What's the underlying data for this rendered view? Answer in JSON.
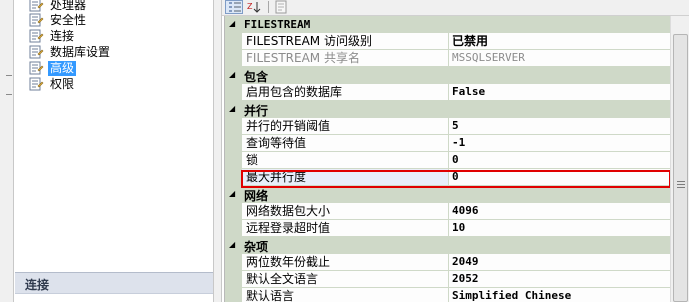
{
  "nav": {
    "items": [
      {
        "label": "处理器",
        "icon": "page-icon"
      },
      {
        "label": "安全性",
        "icon": "page-icon"
      },
      {
        "label": "连接",
        "icon": "page-icon"
      },
      {
        "label": "数据库设置",
        "icon": "page-icon"
      },
      {
        "label": "高级",
        "icon": "page-icon",
        "selected": true
      },
      {
        "label": "权限",
        "icon": "page-icon"
      }
    ],
    "connection_header": "连接"
  },
  "toolbar": {
    "buttons": [
      "categorized-icon",
      "alphabetical-sort-icon",
      "property-pages-icon"
    ]
  },
  "grid": {
    "categories": [
      {
        "label": "FILESTREAM",
        "properties": [
          {
            "name": "FILESTREAM 访问级别",
            "value": "已禁用"
          },
          {
            "name": "FILESTREAM 共享名",
            "value": "MSSQLSERVER",
            "disabled": true
          }
        ]
      },
      {
        "label": "包含",
        "properties": [
          {
            "name": "启用包含的数据库",
            "value": "False"
          }
        ]
      },
      {
        "label": "并行",
        "properties": [
          {
            "name": "并行的开销阈值",
            "value": "5"
          },
          {
            "name": "查询等待值",
            "value": "-1"
          },
          {
            "name": "锁",
            "value": "0"
          },
          {
            "name": "最大并行度",
            "value": "0",
            "highlighted": true
          }
        ]
      },
      {
        "label": "网络",
        "properties": [
          {
            "name": "网络数据包大小",
            "value": "4096"
          },
          {
            "name": "远程登录超时值",
            "value": "10"
          }
        ]
      },
      {
        "label": "杂项",
        "properties": [
          {
            "name": "两位数年份截止",
            "value": "2049"
          },
          {
            "name": "默认全文语言",
            "value": "2052"
          },
          {
            "name": "默认语言",
            "value": "Simplified Chinese"
          }
        ]
      }
    ]
  },
  "colors": {
    "category_band": "#cfd9c8",
    "selection": "#3399ff",
    "highlight_border": "#e00000"
  }
}
